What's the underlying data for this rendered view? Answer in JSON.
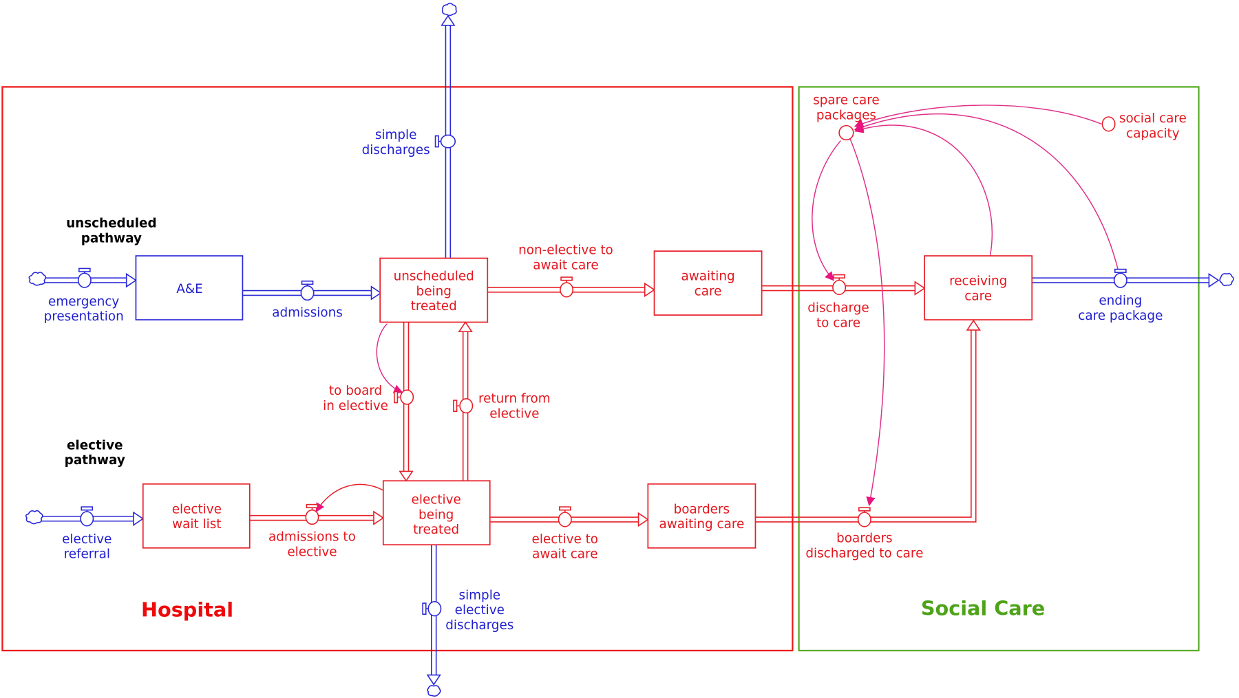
{
  "regions": {
    "hospital": {
      "title": "Hospital",
      "color": "#ee0a0a"
    },
    "social_care": {
      "title": "Social Care",
      "color": "#4ea31a"
    }
  },
  "pathway_labels": {
    "unscheduled": [
      "unscheduled",
      "pathway"
    ],
    "elective": [
      "elective",
      "pathway"
    ]
  },
  "stocks": {
    "ae": [
      "A&E"
    ],
    "unscheduled_being_treated": [
      "unscheduled",
      "being",
      "treated"
    ],
    "awaiting_care": [
      "awaiting",
      "care"
    ],
    "elective_wait_list": [
      "elective",
      "wait list"
    ],
    "elective_being_treated": [
      "elective",
      "being",
      "treated"
    ],
    "boarders_awaiting_care": [
      "boarders",
      "awaiting care"
    ],
    "receiving_care": [
      "receiving",
      "care"
    ]
  },
  "flows": {
    "emergency_presentation": [
      "emergency",
      "presentation"
    ],
    "admissions": [
      "admissions"
    ],
    "simple_discharges": [
      "simple",
      "discharges"
    ],
    "non_elective_to_await_care": [
      "non-elective to",
      "await care"
    ],
    "to_board_in_elective": [
      "to board",
      "in elective"
    ],
    "return_from_elective": [
      "return from",
      "elective"
    ],
    "elective_referral": [
      "elective",
      "referral"
    ],
    "admissions_to_elective": [
      "admissions to",
      "elective"
    ],
    "elective_to_await_care": [
      "elective to",
      "await care"
    ],
    "simple_elective_discharges": [
      "simple",
      "elective",
      "discharges"
    ],
    "discharge_to_care": [
      "discharge",
      "to care"
    ],
    "boarders_discharged_to_care": [
      "boarders",
      "discharged to care"
    ],
    "ending_care_package": [
      "ending",
      "care package"
    ]
  },
  "auxiliaries": {
    "spare_care_packages": [
      "spare care",
      "packages"
    ],
    "social_care_capacity": [
      "social care",
      "capacity"
    ]
  },
  "colors": {
    "blue": "#2a2ad8",
    "red": "#e8202a",
    "link": "#e0308a",
    "green": "#5aac2a"
  }
}
